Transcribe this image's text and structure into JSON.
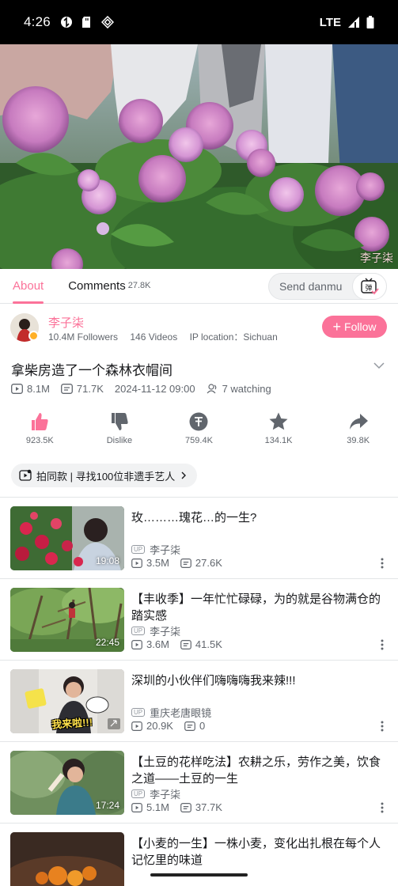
{
  "status_bar": {
    "time": "4:26",
    "network": "LTE"
  },
  "video": {
    "watermark": "李子柒"
  },
  "tabs": {
    "about": "About",
    "comments": "Comments",
    "comments_count": "27.8K",
    "danmu_placeholder": "Send danmu",
    "danmu_button": "弹"
  },
  "uploader": {
    "name": "李子柒",
    "followers": "10.4M Followers",
    "videos": "146 Videos",
    "ip_location": "IP location：Sichuan",
    "follow_label": "Follow"
  },
  "video_info": {
    "title": "拿柴房造了一个森林衣帽间",
    "views": "8.1M",
    "danmaku": "71.7K",
    "date": "2024-11-12 09:00",
    "watching": "7 watching"
  },
  "actions": [
    {
      "icon": "thumbs-up-icon",
      "label": "923.5K"
    },
    {
      "icon": "thumbs-down-icon",
      "label": "Dislike"
    },
    {
      "icon": "coin-icon",
      "label": "759.4K"
    },
    {
      "icon": "star-icon",
      "label": "134.1K"
    },
    {
      "icon": "share-icon",
      "label": "39.8K"
    }
  ],
  "tag_chip": {
    "label": "拍同款 | 寻找100位非遗手艺人"
  },
  "recommendations": [
    {
      "title": "玫………瑰花…的一生?",
      "uploader": "李子柒",
      "views": "3.5M",
      "danmaku": "27.6K",
      "duration": "19:08"
    },
    {
      "title": "【丰收季】一年忙忙碌碌，为的就是谷物满仓的踏实感",
      "uploader": "李子柒",
      "views": "3.6M",
      "danmaku": "41.5K",
      "duration": "22:45"
    },
    {
      "title": "深圳的小伙伴们嗨嗨嗨我来辣!!!",
      "uploader": "重庆老唐眼镜",
      "views": "20.9K",
      "danmaku": "0",
      "duration": "",
      "thumb_text": "我来啦!!!"
    },
    {
      "title": "【土豆的花样吃法】农耕之乐，劳作之美，饮食之道——土豆的一生",
      "uploader": "李子柒",
      "views": "5.1M",
      "danmaku": "37.7K",
      "duration": "17:24"
    },
    {
      "title": "【小麦的一生】一株小麦，变化出扎根在每个人记忆里的味道",
      "uploader": "",
      "views": "",
      "danmaku": "",
      "duration": ""
    }
  ],
  "colors": {
    "accent": "#fb7299",
    "text": "#18191c",
    "secondary": "#61666d"
  }
}
